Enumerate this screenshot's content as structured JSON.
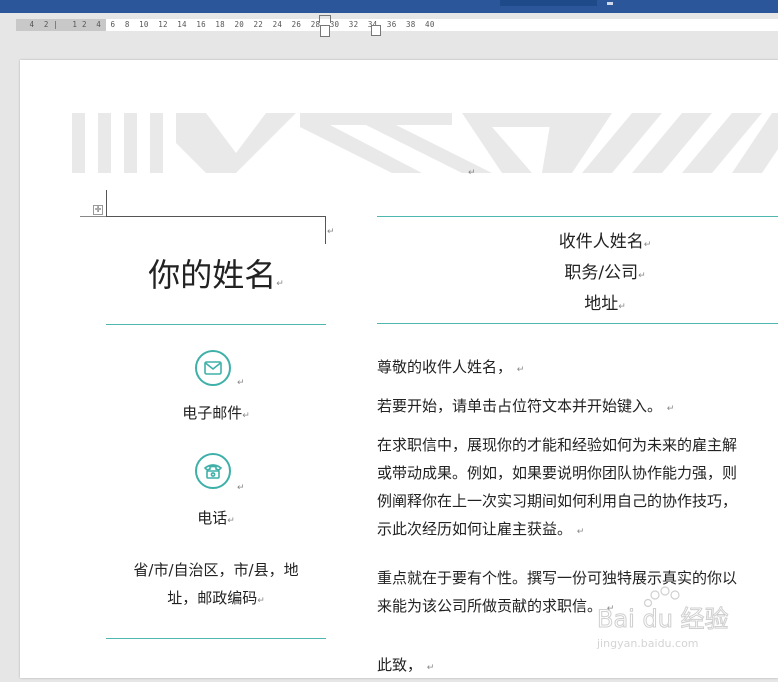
{
  "ruler": {
    "text": "  4  2 |   1 2  4  6  8  10  12  14  16  18  20  22  24  26  28  30  32  34  36  38  40"
  },
  "icons": {
    "email": "envelope-icon",
    "phone": "telephone-icon",
    "table_move": "table-move-handle-icon",
    "paragraph": "paragraph-mark-icon"
  },
  "colors": {
    "accent": "#3eb0a8",
    "titlebar": "#2b579a"
  },
  "resume": {
    "name": "你的姓名",
    "email_label": "电子邮件",
    "phone_label": "电话",
    "address_line1": "省/市/自治区，市/县，地",
    "address_line2": "址，邮政编码"
  },
  "recipient": {
    "name": "收件人姓名",
    "title": "职务/公司",
    "address": "地址"
  },
  "letter": {
    "greeting": "尊敬的收件人姓名，",
    "p1": "若要开始，请单击占位符文本并开始键入。",
    "p2_l1": "在求职信中，展现你的才能和经验如何为未来的雇主解",
    "p2_l2": "或带动成果。例如，如果要说明你团队协作能力强，则",
    "p2_l3": "例阐释你在上一次实习期间如何利用自己的协作技巧，",
    "p2_l4": "示此次经历如何让雇主获益。",
    "p3_l1": "重点就在于要有个性。撰写一份可独特展示真实的你以",
    "p3_l2": "来能为该公司所做贡献的求职信。",
    "closing": "此致，"
  },
  "watermark": {
    "brand": "Bai du 经验",
    "url": "jingyan.baidu.com"
  }
}
